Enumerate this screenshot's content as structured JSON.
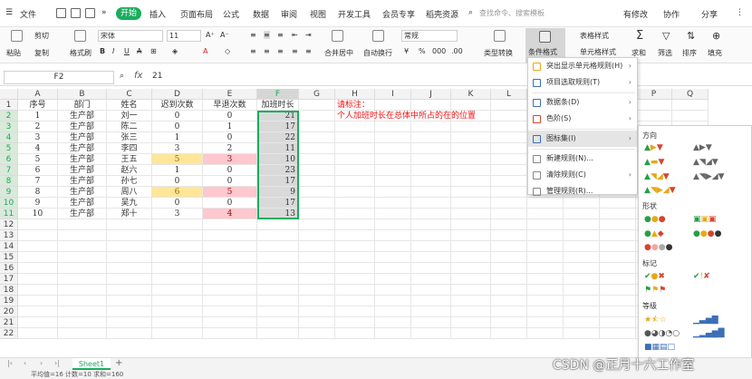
{
  "menubar": {
    "file": "文件",
    "start": "开始",
    "items": [
      "插入",
      "页面布局",
      "公式",
      "数据",
      "审阅",
      "视图",
      "开发工具",
      "会员专享",
      "稻壳资源"
    ],
    "search_placeholder": "查找命令、搜索模板",
    "has_changes": "有修改",
    "collab": "协作",
    "share": "分享"
  },
  "ribbon": {
    "cut": "剪切",
    "paste": "粘贴",
    "copy": "复制",
    "format_painter": "格式刷",
    "font": "宋体",
    "font_size": "11",
    "merge_center": "合并居中",
    "auto_wrap": "自动换行",
    "number_format": "常规",
    "type_convert": "类型转换",
    "cond_format": "条件格式",
    "table_style": "表格样式",
    "cell_style": "单元格样式",
    "sum": "求和",
    "filter": "筛选",
    "sort": "排序",
    "fill": "填充"
  },
  "formula_bar": {
    "name_box": "F2",
    "fx": "fx",
    "value": "21"
  },
  "columns": [
    "A",
    "B",
    "C",
    "D",
    "E",
    "F",
    "G",
    "H",
    "I",
    "J",
    "K",
    "L",
    "M",
    "N",
    "O",
    "P",
    "Q"
  ],
  "rows": [
    "1",
    "2",
    "3",
    "4",
    "5",
    "6",
    "7",
    "8",
    "9",
    "10",
    "11",
    "12",
    "13",
    "14",
    "15",
    "16",
    "17",
    "18",
    "19",
    "20",
    "21",
    "22"
  ],
  "table": {
    "headers": [
      "序号",
      "部门",
      "姓名",
      "迟到次数",
      "早退次数",
      "加班时长"
    ],
    "data": [
      [
        "1",
        "生产部",
        "刘一",
        "0",
        "0",
        "21"
      ],
      [
        "2",
        "生产部",
        "陈二",
        "0",
        "1",
        "17"
      ],
      [
        "3",
        "生产部",
        "张三",
        "1",
        "0",
        "22"
      ],
      [
        "4",
        "生产部",
        "李四",
        "3",
        "2",
        "11"
      ],
      [
        "5",
        "生产部",
        "王五",
        "5",
        "3",
        "10"
      ],
      [
        "6",
        "生产部",
        "赵六",
        "1",
        "0",
        "23"
      ],
      [
        "7",
        "生产部",
        "孙七",
        "0",
        "0",
        "17"
      ],
      [
        "8",
        "生产部",
        "周八",
        "6",
        "5",
        "9"
      ],
      [
        "9",
        "生产部",
        "吴九",
        "0",
        "0",
        "17"
      ],
      [
        "10",
        "生产部",
        "郑十",
        "3",
        "4",
        "13"
      ]
    ]
  },
  "note": {
    "title": "请标注：",
    "text": "个人加班时长在总体中所占的在的位置"
  },
  "cf_menu": {
    "items": [
      {
        "label": "突出显示单元格规则(H)",
        "arrow": "›"
      },
      {
        "label": "项目选取规则(T)",
        "arrow": "›"
      },
      {
        "label": "数据条(D)",
        "arrow": "›"
      },
      {
        "label": "色阶(S)",
        "arrow": "›"
      },
      {
        "label": "图标集(I)",
        "arrow": "›"
      },
      {
        "label": "新建规则(N)...",
        "arrow": ""
      },
      {
        "label": "清除规则(C)",
        "arrow": "›"
      },
      {
        "label": "管理规则(R)...",
        "arrow": ""
      }
    ]
  },
  "icon_panel": {
    "sections": [
      "方向",
      "形状",
      "标记",
      "等级"
    ]
  },
  "sheet_tab": "Sheet1",
  "status": "平均值=16  计数=10  求和=160",
  "watermark": "CSDN @正月十六工作室",
  "colors": {
    "green": "#1aad5d",
    "yellow_fill": "#ffe699",
    "pink_fill": "#ffc7ce",
    "selection_gray": "#d9d9d9",
    "note_red": "#ee1111"
  }
}
